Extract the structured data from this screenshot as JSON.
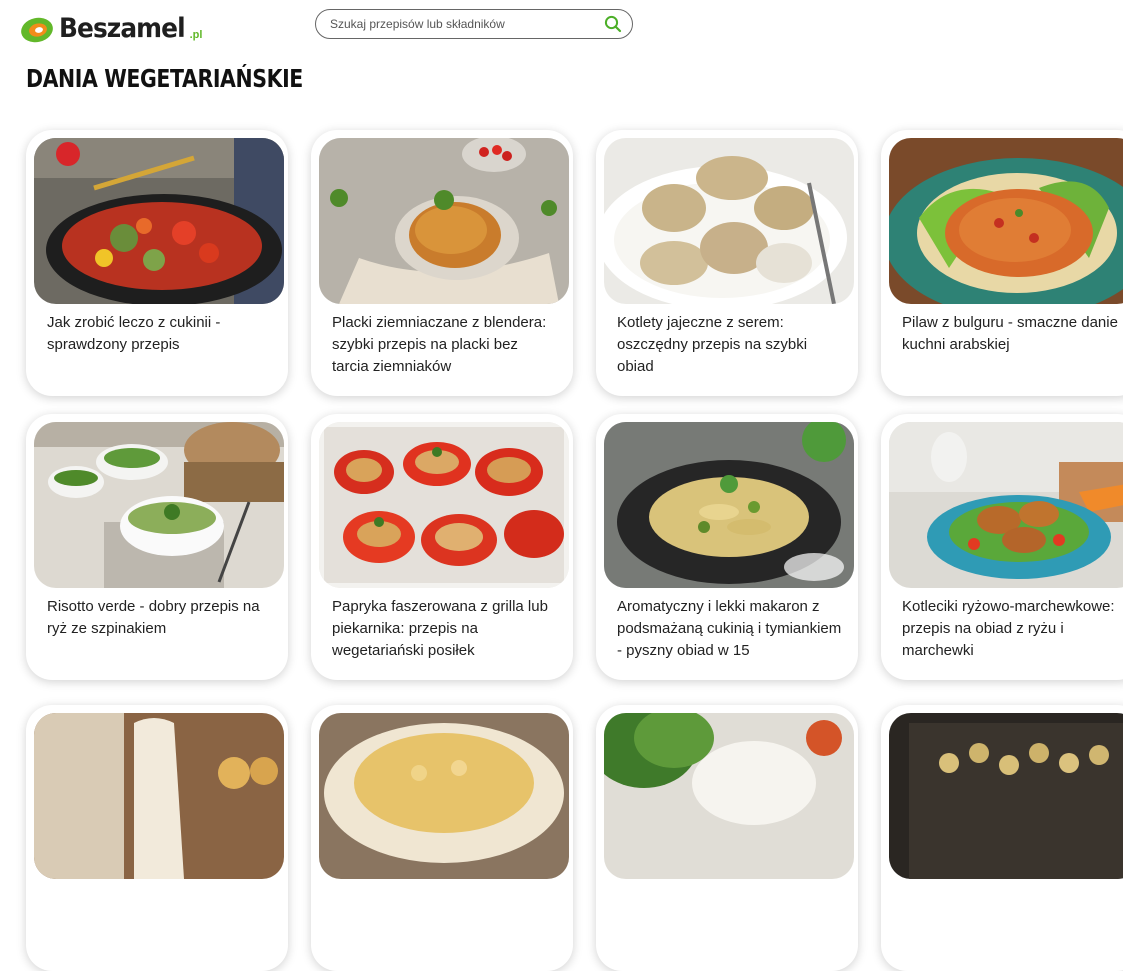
{
  "header": {
    "logo_text": "Beszamel",
    "logo_suffix": ".pl",
    "search_placeholder": "Szukaj przepisów lub składników"
  },
  "page_title": "DANIA WEGETARIAŃSKIE",
  "cards": [
    {
      "title": "Jak zrobić leczo z cukinii - sprawdzony przepis"
    },
    {
      "title": "Placki ziemniaczane z blendera: szybki przepis na placki bez tarcia ziemniaków"
    },
    {
      "title": "Kotlety jajeczne z serem: oszczędny przepis na szybki obiad"
    },
    {
      "title": "Pilaw z bulguru - smaczne danie kuchni arabskiej"
    },
    {
      "title": "Risotto verde - dobry przepis na ryż ze szpinakiem"
    },
    {
      "title": "Papryka faszerowana z grilla lub piekarnika: przepis na wegetariański posiłek"
    },
    {
      "title": "Aromatyczny i lekki makaron z podsmażaną cukinią i tymiankiem - pyszny obiad w 15"
    },
    {
      "title": "Kotleciki ryżowo-marchewkowe: przepis na obiad z ryżu i marchewki"
    },
    {
      "title": ""
    },
    {
      "title": ""
    },
    {
      "title": ""
    },
    {
      "title": ""
    }
  ],
  "colors": {
    "brand_green": "#62b82a",
    "logo_orange": "#f28c1a",
    "search_icon": "#4caf28"
  },
  "icons": {
    "logo": "beszamel-logo-icon",
    "search": "search-icon"
  }
}
